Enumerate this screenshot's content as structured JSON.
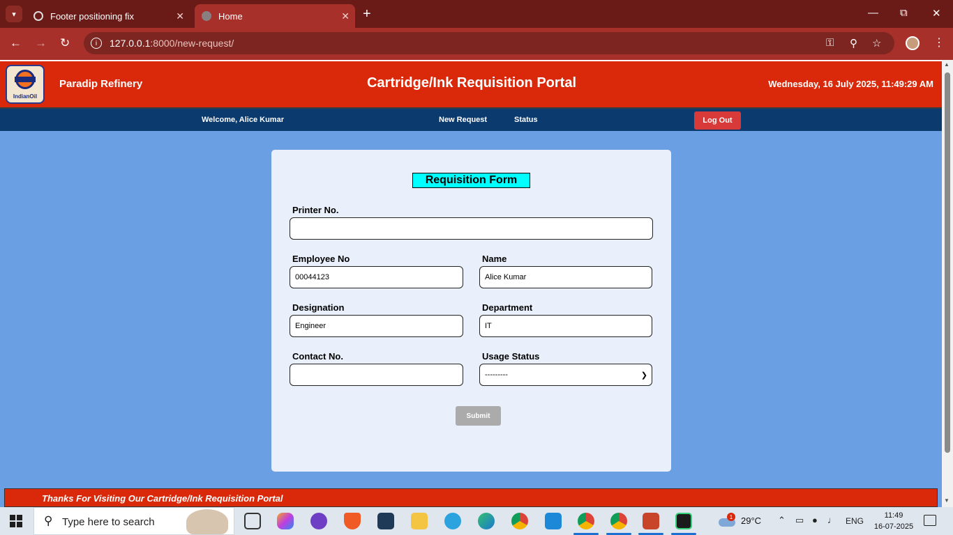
{
  "browser": {
    "tabs": [
      {
        "title": "Footer positioning fix"
      },
      {
        "title": "Home"
      }
    ],
    "url_host": "127.0.0.1",
    "url_path": ":8000/new-request/"
  },
  "header": {
    "org_name": "Paradip Refinery",
    "portal_title": "Cartridge/Ink Requisition Portal",
    "datetime": "Wednesday, 16 July 2025, 11:49:29 AM",
    "logo_text": "IndianOil"
  },
  "nav": {
    "welcome": "Welcome, Alice Kumar",
    "new_request": "New Request",
    "status": "Status",
    "logout": "Log Out"
  },
  "form": {
    "title": "Requisition Form",
    "printer_no_label": "Printer No.",
    "printer_no_value": "",
    "employee_no_label": "Employee No",
    "employee_no_value": "00044123",
    "name_label": "Name",
    "name_value": "Alice Kumar",
    "designation_label": "Designation",
    "designation_value": "Engineer",
    "department_label": "Department",
    "department_value": "IT",
    "contact_label": "Contact No.",
    "contact_value": "",
    "usage_status_label": "Usage Status",
    "usage_status_selected": "---------",
    "submit_label": "Submit"
  },
  "footer": {
    "text": "Thanks For Visiting Our Cartridge/Ink Requisition Portal"
  },
  "taskbar": {
    "search_placeholder": "Type here to search",
    "temperature": "29°C",
    "weather_badge": "1",
    "language": "ENG",
    "time": "11:49",
    "date": "16-07-2025"
  },
  "colors": {
    "header_red": "#d9290a",
    "nav_blue": "#0b3a6f",
    "page_bg": "#6a9fe3",
    "form_title_bg": "#00ffff",
    "logout_red": "#d83a3a"
  }
}
